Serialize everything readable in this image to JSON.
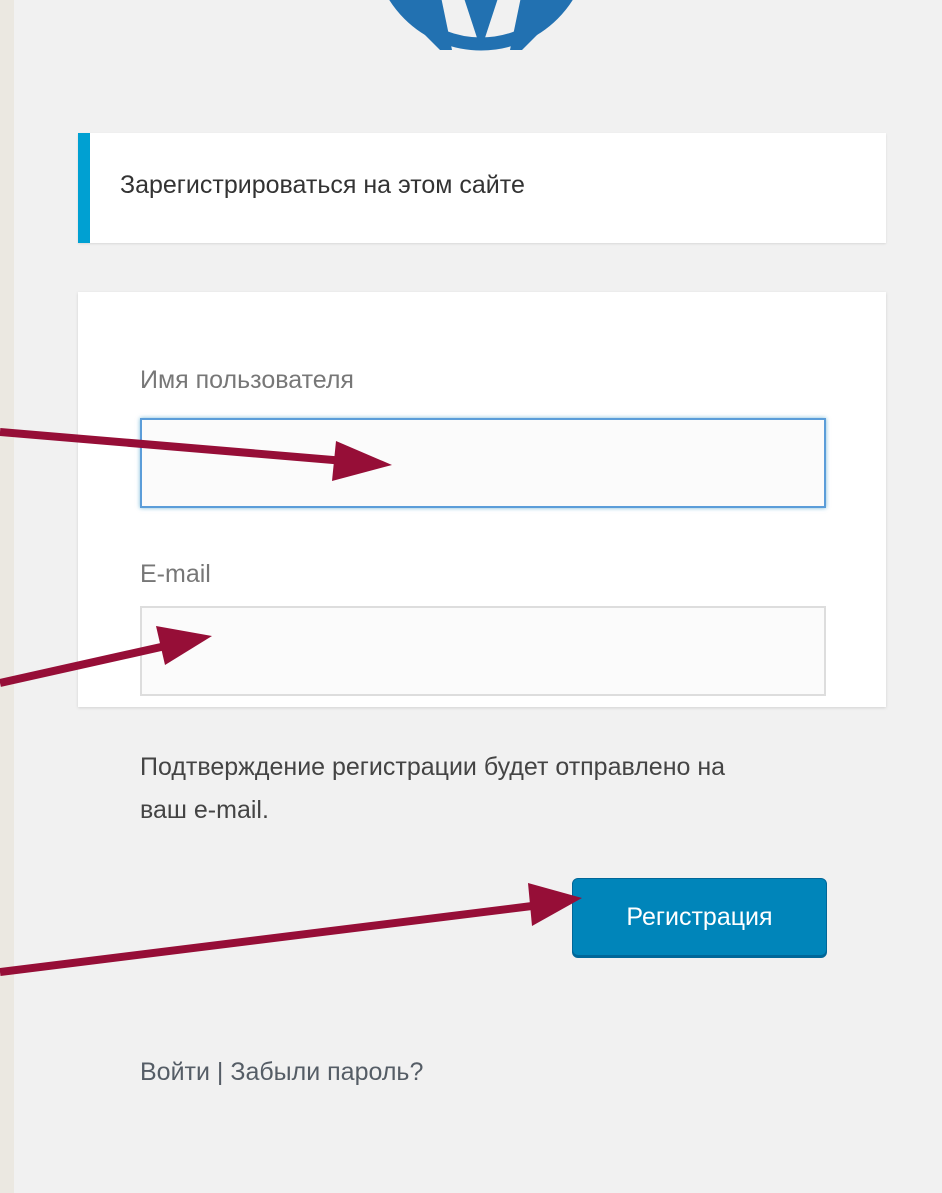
{
  "logo": {
    "icon": "wordpress-logo-icon",
    "color": "#2271b1"
  },
  "notice": {
    "text": "Зарегистрироваться на этом сайте",
    "accent_color": "#00a0d2"
  },
  "form": {
    "username_label": "Имя пользователя",
    "username_value": "",
    "email_label": "E-mail",
    "email_value": "",
    "hint": "Подтверждение регистрации будет отправлено на ваш e-mail.",
    "submit_label": "Регистрация",
    "submit_color": "#0085ba"
  },
  "nav": {
    "login_label": "Войти",
    "separator": " | ",
    "lost_password_label": "Забыли пароль?"
  },
  "annotations": {
    "arrow_color": "#960e37"
  }
}
